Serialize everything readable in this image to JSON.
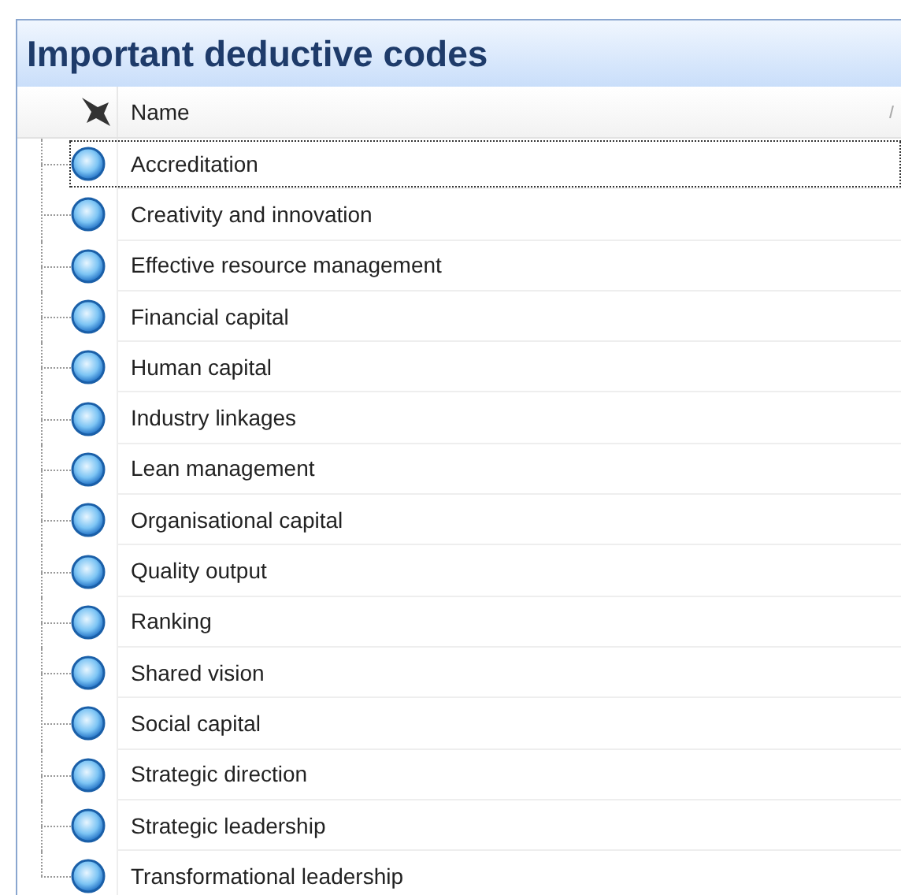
{
  "panel": {
    "title": "Important deductive codes"
  },
  "table": {
    "columns": [
      {
        "label": "Name"
      }
    ],
    "rows": [
      {
        "name": "Accreditation",
        "selected": true
      },
      {
        "name": "Creativity and innovation",
        "selected": false
      },
      {
        "name": "Effective resource management",
        "selected": false
      },
      {
        "name": "Financial capital",
        "selected": false
      },
      {
        "name": "Human capital",
        "selected": false
      },
      {
        "name": "Industry linkages",
        "selected": false
      },
      {
        "name": "Lean management",
        "selected": false
      },
      {
        "name": "Organisational capital",
        "selected": false
      },
      {
        "name": "Quality output",
        "selected": false
      },
      {
        "name": "Ranking",
        "selected": false
      },
      {
        "name": "Shared vision",
        "selected": false
      },
      {
        "name": "Social capital",
        "selected": false
      },
      {
        "name": "Strategic direction",
        "selected": false
      },
      {
        "name": "Strategic leadership",
        "selected": false
      },
      {
        "name": "Transformational leadership",
        "selected": false
      }
    ]
  }
}
